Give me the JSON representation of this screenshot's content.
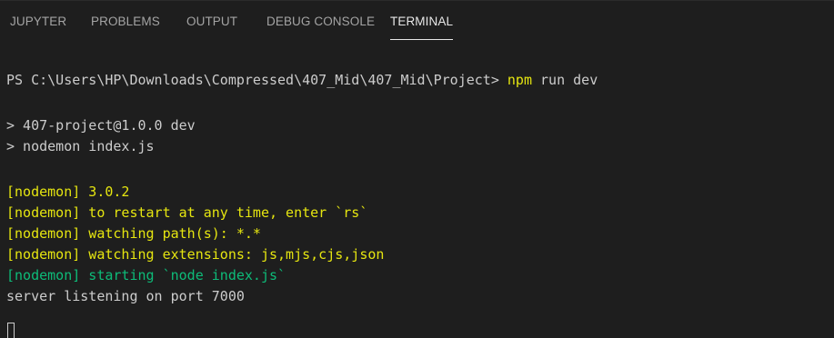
{
  "tabs": [
    {
      "label": "JUPYTER"
    },
    {
      "label": "PROBLEMS"
    },
    {
      "label": "OUTPUT"
    },
    {
      "label": "DEBUG CONSOLE"
    },
    {
      "label": "TERMINAL"
    }
  ],
  "active_tab": "TERMINAL",
  "terminal": {
    "prompt": "PS C:\\Users\\HP\\Downloads\\Compressed\\407_Mid\\407_Mid\\Project>",
    "command_name": "npm",
    "command_args": "run dev",
    "script_line_1": "> 407-project@1.0.0 dev",
    "script_line_2": "> nodemon index.js",
    "nodemon_lines": [
      "[nodemon] 3.0.2",
      "[nodemon] to restart at any time, enter `rs`",
      "[nodemon] watching path(s): *.*",
      "[nodemon] watching extensions: js,mjs,cjs,json"
    ],
    "starting_line": "[nodemon] starting `node index.js`",
    "server_line": "server listening on port 7000"
  },
  "colors": {
    "background": "#1e1e1e",
    "text": "#cccccc",
    "yellow": "#e5e510",
    "green": "#0dbc79"
  }
}
